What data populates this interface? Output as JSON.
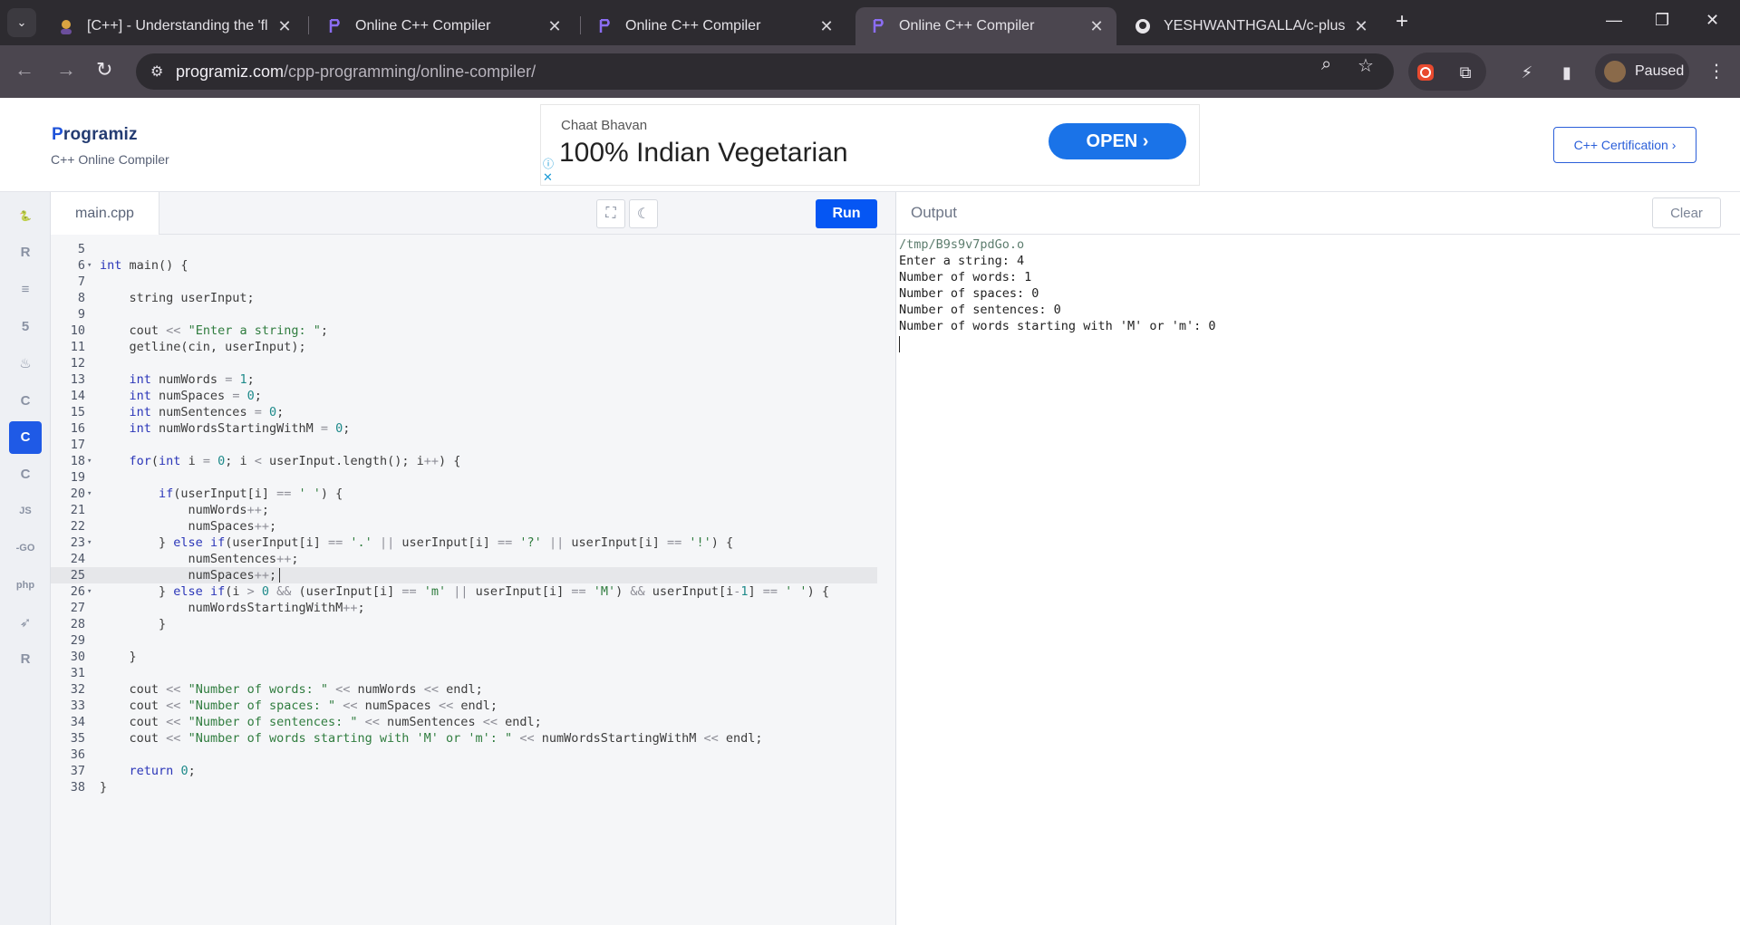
{
  "browser": {
    "tabs": [
      {
        "title": "[C++] - Understanding the 'floa",
        "icon": "user-avatar-favicon"
      },
      {
        "title": "Online C++ Compiler",
        "icon": "programiz-favicon"
      },
      {
        "title": "Online C++ Compiler",
        "icon": "programiz-favicon"
      },
      {
        "title": "Online C++ Compiler",
        "icon": "programiz-favicon",
        "active": true
      },
      {
        "title": "YESHWANTHGALLA/c-plus-plu",
        "icon": "github-favicon"
      }
    ],
    "url_host": "programiz.com",
    "url_path": "/cpp-programming/online-compiler/",
    "profile_label": "Paused"
  },
  "header": {
    "logo_text": "rogramiz",
    "logo_p": "P",
    "subtitle": "C++ Online Compiler",
    "certification_label": "C++ Certification ›"
  },
  "ad": {
    "brand": "Chaat Bhavan",
    "headline": "100% Indian Vegetarian",
    "cta": "OPEN ›"
  },
  "editor": {
    "file_name": "main.cpp",
    "run_label": "Run",
    "lines": [
      {
        "n": "5",
        "fold": false,
        "html": ""
      },
      {
        "n": "6",
        "fold": true,
        "html": "<span class=\"kw\">int</span> main() {"
      },
      {
        "n": "7",
        "fold": false,
        "html": ""
      },
      {
        "n": "8",
        "fold": false,
        "html": "    string userInput;"
      },
      {
        "n": "9",
        "fold": false,
        "html": ""
      },
      {
        "n": "10",
        "fold": false,
        "html": "    cout <span class=\"op\">&lt;&lt;</span> <span class=\"str\">\"Enter a string: \"</span>;"
      },
      {
        "n": "11",
        "fold": false,
        "html": "    getline(cin, userInput);"
      },
      {
        "n": "12",
        "fold": false,
        "html": ""
      },
      {
        "n": "13",
        "fold": false,
        "html": "    <span class=\"kw\">int</span> numWords <span class=\"op\">=</span> <span class=\"num\">1</span>;"
      },
      {
        "n": "14",
        "fold": false,
        "html": "    <span class=\"kw\">int</span> numSpaces <span class=\"op\">=</span> <span class=\"num\">0</span>;"
      },
      {
        "n": "15",
        "fold": false,
        "html": "    <span class=\"kw\">int</span> numSentences <span class=\"op\">=</span> <span class=\"num\">0</span>;"
      },
      {
        "n": "16",
        "fold": false,
        "html": "    <span class=\"kw\">int</span> numWordsStartingWithM <span class=\"op\">=</span> <span class=\"num\">0</span>;"
      },
      {
        "n": "17",
        "fold": false,
        "html": ""
      },
      {
        "n": "18",
        "fold": true,
        "html": "    <span class=\"kw\">for</span>(<span class=\"kw\">int</span> i <span class=\"op\">=</span> <span class=\"num\">0</span>; i <span class=\"op\">&lt;</span> userInput.length(); i<span class=\"op\">++</span>) {"
      },
      {
        "n": "19",
        "fold": false,
        "html": ""
      },
      {
        "n": "20",
        "fold": true,
        "html": "        <span class=\"kw\">if</span>(userInput[i] <span class=\"op\">==</span> <span class=\"str\">' '</span>) {"
      },
      {
        "n": "21",
        "fold": false,
        "html": "            numWords<span class=\"op\">++</span>;"
      },
      {
        "n": "22",
        "fold": false,
        "html": "            numSpaces<span class=\"op\">++</span>;"
      },
      {
        "n": "23",
        "fold": true,
        "html": "        } <span class=\"kw\">else</span> <span class=\"kw\">if</span>(userInput[i] <span class=\"op\">==</span> <span class=\"str\">'.'</span> <span class=\"op\">||</span> userInput[i] <span class=\"op\">==</span> <span class=\"str\">'?'</span> <span class=\"op\">||</span> userInput[i] <span class=\"op\">==</span> <span class=\"str\">'!'</span>) {"
      },
      {
        "n": "24",
        "fold": false,
        "html": "            numSentences<span class=\"op\">++</span>;"
      },
      {
        "n": "25",
        "fold": false,
        "html": "            numSpaces<span class=\"op\">++</span>;<span class=\"cursor\"></span>",
        "highlight": true
      },
      {
        "n": "26",
        "fold": true,
        "html": "        } <span class=\"kw\">else</span> <span class=\"kw\">if</span>(i <span class=\"op\">&gt;</span> <span class=\"num\">0</span> <span class=\"op\">&amp;&amp;</span> (userInput[i] <span class=\"op\">==</span> <span class=\"str\">'m'</span> <span class=\"op\">||</span> userInput[i] <span class=\"op\">==</span> <span class=\"str\">'M'</span>) <span class=\"op\">&amp;&amp;</span> userInput[i<span class=\"op\">-</span><span class=\"num\">1</span>] <span class=\"op\">==</span> <span class=\"str\">' '</span>) {"
      },
      {
        "n": "27",
        "fold": false,
        "html": "            numWordsStartingWithM<span class=\"op\">++</span>;"
      },
      {
        "n": "28",
        "fold": false,
        "html": "        }"
      },
      {
        "n": "29",
        "fold": false,
        "html": ""
      },
      {
        "n": "30",
        "fold": false,
        "html": "    }"
      },
      {
        "n": "31",
        "fold": false,
        "html": ""
      },
      {
        "n": "32",
        "fold": false,
        "html": "    cout <span class=\"op\">&lt;&lt;</span> <span class=\"str\">\"Number of words: \"</span> <span class=\"op\">&lt;&lt;</span> numWords <span class=\"op\">&lt;&lt;</span> endl;"
      },
      {
        "n": "33",
        "fold": false,
        "html": "    cout <span class=\"op\">&lt;&lt;</span> <span class=\"str\">\"Number of spaces: \"</span> <span class=\"op\">&lt;&lt;</span> numSpaces <span class=\"op\">&lt;&lt;</span> endl;"
      },
      {
        "n": "34",
        "fold": false,
        "html": "    cout <span class=\"op\">&lt;&lt;</span> <span class=\"str\">\"Number of sentences: \"</span> <span class=\"op\">&lt;&lt;</span> numSentences <span class=\"op\">&lt;&lt;</span> endl;"
      },
      {
        "n": "35",
        "fold": false,
        "html": "    cout <span class=\"op\">&lt;&lt;</span> <span class=\"str\">\"Number of words starting with 'M' or 'm': \"</span> <span class=\"op\">&lt;&lt;</span> numWordsStartingWithM <span class=\"op\">&lt;&lt;</span> endl;"
      },
      {
        "n": "36",
        "fold": false,
        "html": ""
      },
      {
        "n": "37",
        "fold": false,
        "html": "    <span class=\"kw\">return</span> <span class=\"num\">0</span>;"
      },
      {
        "n": "38",
        "fold": false,
        "html": "}"
      }
    ]
  },
  "output": {
    "title": "Output",
    "clear_label": "Clear",
    "lines": [
      "/tmp/B9s9v7pdGo.o",
      "Enter a string: 4",
      "Number of words: 1",
      "Number of spaces: 0",
      "Number of sentences: 0",
      "Number of words starting with 'M' or 'm': 0"
    ]
  },
  "rail": [
    {
      "name": "python-icon",
      "glyph": "🐍"
    },
    {
      "name": "r-lang-icon",
      "glyph": "R"
    },
    {
      "name": "sql-icon",
      "glyph": "≡"
    },
    {
      "name": "html-icon",
      "glyph": "5"
    },
    {
      "name": "java-icon",
      "glyph": "♨"
    },
    {
      "name": "c-lang-icon",
      "glyph": "C"
    },
    {
      "name": "cpp-lang-icon",
      "glyph": "C",
      "active": true
    },
    {
      "name": "csharp-icon",
      "glyph": "C"
    },
    {
      "name": "javascript-icon",
      "glyph": "JS"
    },
    {
      "name": "go-icon",
      "glyph": "-GO"
    },
    {
      "name": "php-icon",
      "glyph": "php"
    },
    {
      "name": "swift-icon",
      "glyph": "➶"
    },
    {
      "name": "rust-icon",
      "glyph": "R"
    }
  ],
  "colors": {
    "accent": "#0556f3",
    "chrome_dark": "#2d2b30",
    "chrome_toolbar": "#4b464f"
  }
}
